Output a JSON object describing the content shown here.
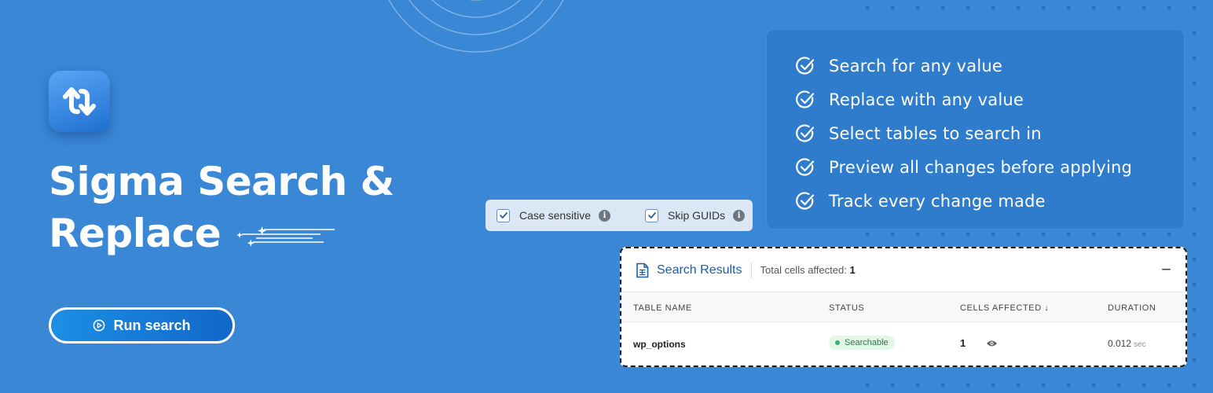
{
  "app": {
    "title_line1": "Sigma Search &",
    "title_line2": "Replace",
    "run_button_label": "Run search"
  },
  "features": [
    "Search for any value",
    "Replace with any value",
    "Select tables to search in",
    "Preview all changes before applying",
    "Track every change made"
  ],
  "options": {
    "case_sensitive_label": "Case sensitive",
    "skip_guids_label": "Skip GUIDs",
    "info_glyph": "i"
  },
  "results": {
    "title": "Search Results",
    "total_label": "Total cells affected:",
    "total_value": "1",
    "collapse_glyph": "−",
    "columns": {
      "table_name": "TABLE NAME",
      "status": "STATUS",
      "cells_affected": "CELLS AFFECTED ↓",
      "duration": "DURATION"
    },
    "rows": [
      {
        "table_name": "wp_options",
        "status": "Searchable",
        "cells": "1",
        "duration": "0.012",
        "unit": "sec"
      }
    ]
  },
  "colors": {
    "background": "#3a87d6",
    "panel": "#2f7ccc",
    "accent": "#1b5ea6",
    "status_green": "#34b26a"
  },
  "icons": [
    "swap-arrows-icon",
    "check-circle-icon",
    "play-circle-icon",
    "info-icon",
    "spreadsheet-icon",
    "eye-icon",
    "sparkle-icon"
  ]
}
